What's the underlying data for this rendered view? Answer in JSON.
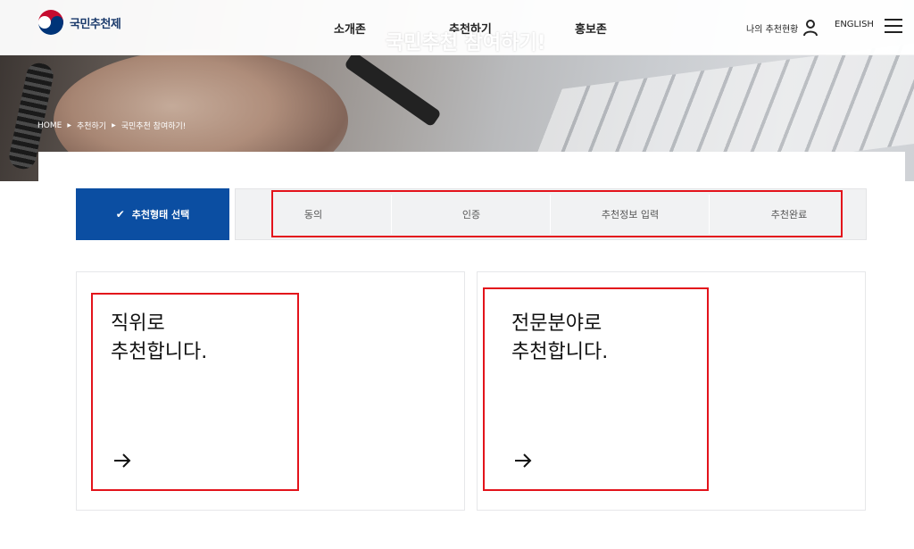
{
  "header": {
    "logo_text": "국민추천제",
    "nav": [
      "소개존",
      "추천하기",
      "홍보존"
    ],
    "hero_title": "국민추천 참여하기!",
    "my_status": "나의 추천현황",
    "english": "ENGLISH"
  },
  "breadcrumb": [
    "HOME",
    "추천하기",
    "국민추천 참여하기!"
  ],
  "steps": {
    "active": "추천형태 선택",
    "items": [
      "동의",
      "인증",
      "추천정보 입력",
      "추천완료"
    ]
  },
  "cards": [
    {
      "title": "직위로\n추천합니다."
    },
    {
      "title": "전문분야로\n추천합니다."
    }
  ],
  "colors": {
    "accent": "#0b4ea2",
    "highlight": "#e3131b",
    "step_bg": "#f1f2f3"
  },
  "icons": [
    "logo-taegeuk-icon",
    "user-icon",
    "menu-icon",
    "check-icon",
    "arrow-right-icon"
  ]
}
